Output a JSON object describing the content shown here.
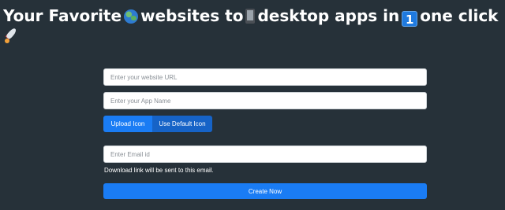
{
  "heading": {
    "part1": "Your Favorite",
    "part2": "websites to",
    "part3": "desktop apps in",
    "part4": "one click",
    "keycap_digit": "1"
  },
  "icons": {
    "globe": "globe-emoji-icon",
    "phone": "mobile-phone-emoji-icon",
    "keycap": "keycap-one-emoji-icon",
    "rocket": "rocket-emoji-icon"
  },
  "form": {
    "url_placeholder": "Enter your website URL",
    "app_name_placeholder": "Enter your App Name",
    "upload_icon_label": "Upload Icon",
    "default_icon_label": "Use Default Icon",
    "email_placeholder": "Enter Email id",
    "email_hint": "Download link will be sent to this email.",
    "create_label": "Create Now"
  },
  "colors": {
    "background": "#263139",
    "primary": "#1a7cf4",
    "primary_dark": "#1663c7"
  }
}
